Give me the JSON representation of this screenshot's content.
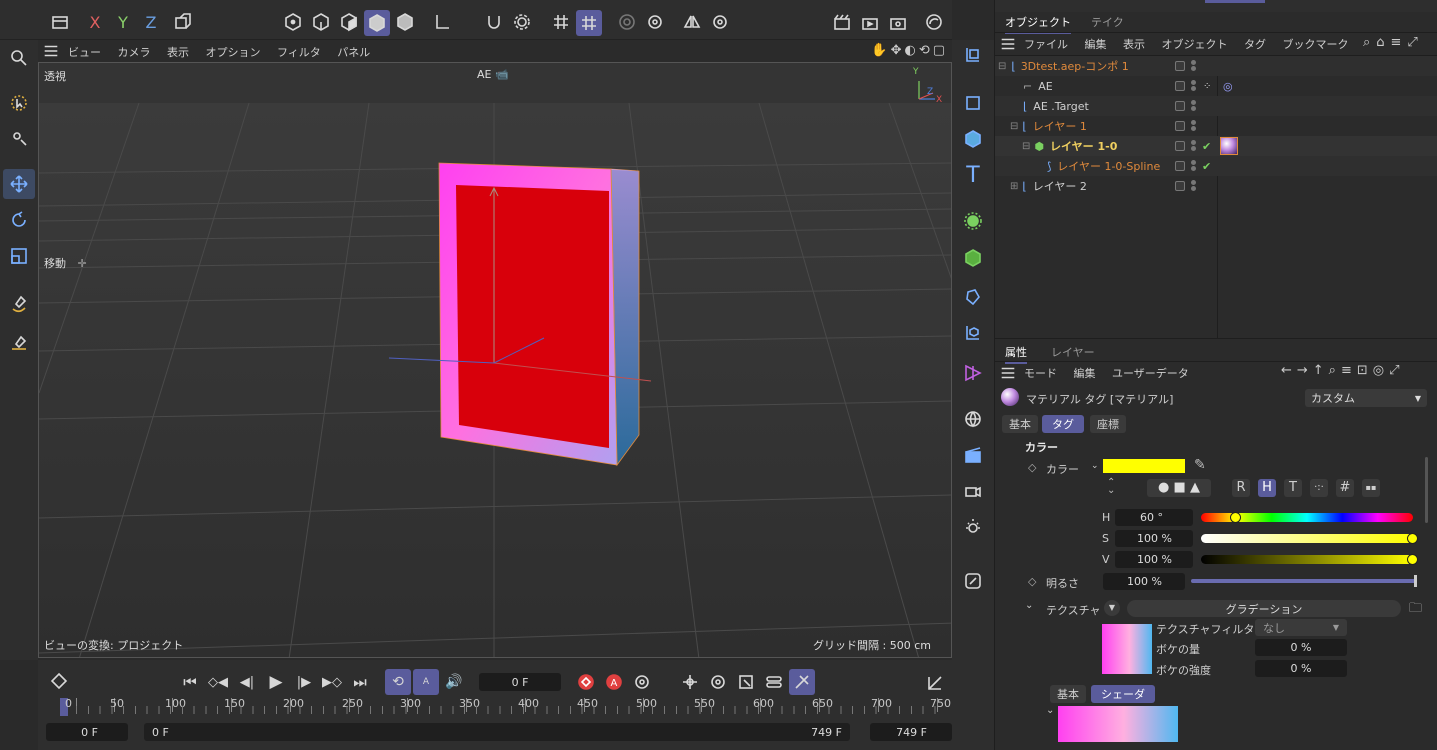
{
  "toolbar_top": {
    "axes": [
      "X",
      "Y",
      "Z"
    ]
  },
  "viewport": {
    "menu": [
      "ビュー",
      "カメラ",
      "表示",
      "オプション",
      "フィルタ",
      "パネル"
    ],
    "view_name": "透視",
    "camera_label": "AE",
    "move_label": "移動",
    "transform_label": "ビューの変換: プロジェクト",
    "grid_spacing": "グリッド間隔 : 500 cm",
    "axis_labels": [
      "Y",
      "Z",
      "X"
    ]
  },
  "object_panel": {
    "tabs": [
      "オブジェクト",
      "テイク"
    ],
    "menu": [
      "ファイル",
      "編集",
      "表示",
      "オブジェクト",
      "タグ",
      "ブックマーク"
    ],
    "items": [
      {
        "label": "3Dtest.aep-コンポ 1",
        "color": "#e08a3c"
      },
      {
        "label": "AE",
        "color": "#d0d0d0"
      },
      {
        "label": "AE .Target",
        "color": "#d0d0d0"
      },
      {
        "label": "レイヤー 1",
        "color": "#e08a3c"
      },
      {
        "label": "レイヤー 1-0",
        "color": "#f0d060"
      },
      {
        "label": "レイヤー 1-0-Spline",
        "color": "#e08a3c"
      },
      {
        "label": "レイヤー 2",
        "color": "#d0d0d0"
      }
    ]
  },
  "attributes": {
    "tabs": [
      "属性",
      "レイヤー"
    ],
    "menu": [
      "モード",
      "編集",
      "ユーザーデータ"
    ],
    "title": "マテリアル タグ [マテリアル]",
    "preset": "カスタム",
    "subtabs": [
      "基本",
      "タグ",
      "座標"
    ],
    "section": "カラー",
    "color_label": "カラー",
    "color_value": "#ffff00",
    "mode_buttons": [
      "R",
      "H",
      "T",
      "·:·",
      "#",
      "▪▪"
    ],
    "h_label": "H",
    "h_value": "60 °",
    "h_fraction": 0.166,
    "s_label": "S",
    "s_value": "100 %",
    "s_fraction": 1.0,
    "v_label": "V",
    "v_value": "100 %",
    "v_fraction": 1.0,
    "brightness_label": "明るさ",
    "brightness_value": "100 %",
    "brightness_fraction": 1.0,
    "texture_label": "テクスチャ",
    "texture_name": "グラデーション",
    "texture_filter_label": "テクスチャフィルタ",
    "texture_filter_value": "なし",
    "blur_amount_label": "ボケの量",
    "blur_amount_value": "0 %",
    "blur_strength_label": "ボケの強度",
    "blur_strength_value": "0 %",
    "bottom_tabs": [
      "基本",
      "シェーダ"
    ]
  },
  "timeline": {
    "current_frame": "0 F",
    "ruler": [
      "0",
      "50",
      "100",
      "150",
      "200",
      "250",
      "300",
      "350",
      "400",
      "450",
      "500",
      "550",
      "600",
      "650",
      "700",
      "750"
    ],
    "start_field": "0 F",
    "range_start": "0 F",
    "range_end": "749 F",
    "end_field": "749 F"
  }
}
